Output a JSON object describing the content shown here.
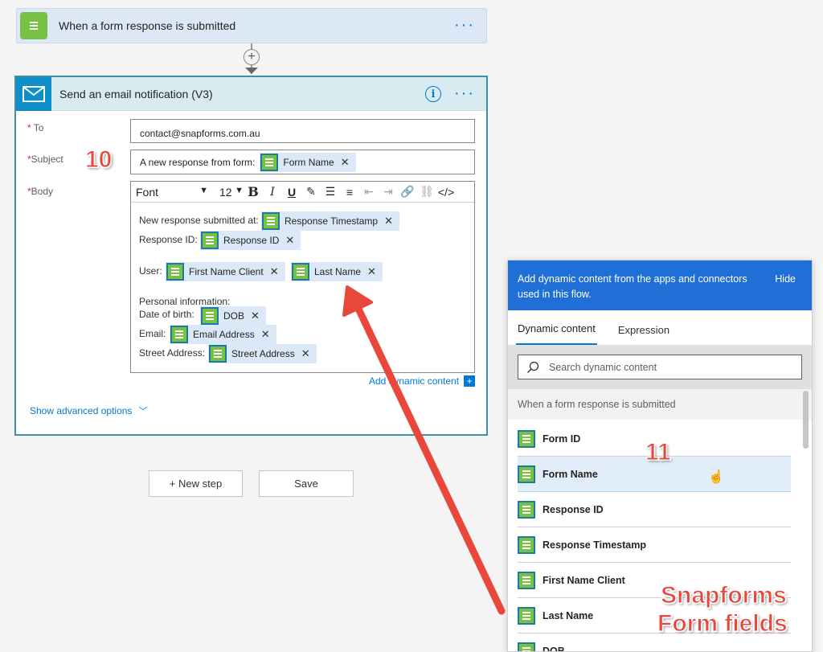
{
  "trigger": {
    "title": "When a form response is submitted",
    "icon": "form-icon"
  },
  "action": {
    "title": "Send an email notification (V3)",
    "fields": {
      "to_label": "To",
      "to_value": "contact@snapforms.com.au",
      "subject_label": "Subject",
      "subject_prefix": "A new response from form:",
      "subject_token": "Form Name",
      "body_label": "Body"
    },
    "toolbar": {
      "font": "Font",
      "size": "12",
      "bold": "B",
      "italic": "I",
      "underline": "U"
    },
    "body": {
      "line1_label": "New response submitted at:",
      "line1_token": "Response Timestamp",
      "line2_label": "Response ID:",
      "line2_token": "Response ID",
      "user_label": "User:",
      "user_token1": "First Name Client",
      "user_token2": "Last Name",
      "personal_label": "Personal information:",
      "dob_label": "Date of birth:",
      "dob_token": "DOB",
      "email_label": "Email:",
      "email_token": "Email Address",
      "street_label": "Street Address:",
      "street_token": "Street Address"
    },
    "add_dynamic": "Add dynamic content",
    "show_advanced": "Show advanced options"
  },
  "buttons": {
    "new_step": "+ New step",
    "save": "Save"
  },
  "annotations": {
    "step10": "10",
    "step11": "11",
    "callout_line1": "Snapforms",
    "callout_line2": "Form fields"
  },
  "panel": {
    "header": "Add dynamic content from the apps and connectors used in this flow.",
    "hide": "Hide",
    "tabs": [
      "Dynamic content",
      "Expression"
    ],
    "search_placeholder": "Search dynamic content",
    "group": "When a form response is submitted",
    "items": [
      "Form ID",
      "Form Name",
      "Response ID",
      "Response Timestamp",
      "First Name Client",
      "Last Name",
      "DOB"
    ]
  },
  "colors": {
    "accent": "#0078d4",
    "panel_header": "#1f6fd6",
    "token_bg": "#dbe8f7",
    "snapforms_green": "#79c142",
    "annotation_red": "#e8483c"
  }
}
